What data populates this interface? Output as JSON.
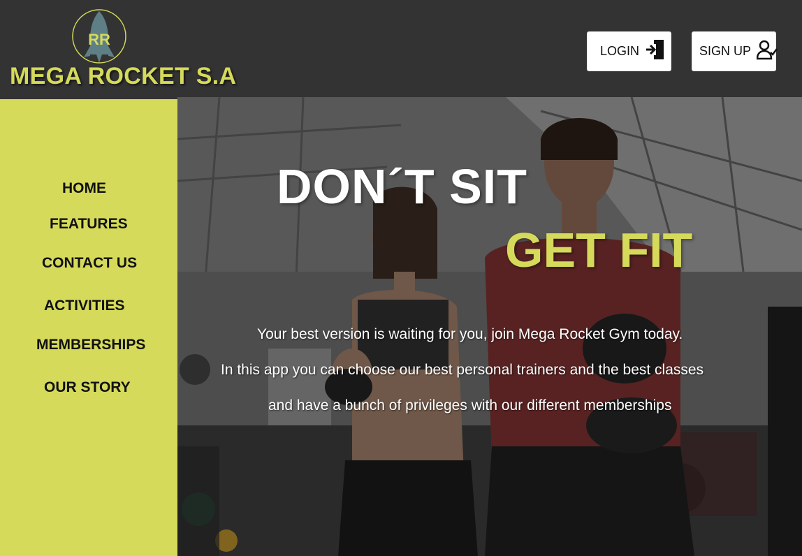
{
  "header": {
    "brand": "MEGA ROCKET S.A",
    "login_label": "LOGIN",
    "signup_label": "SIGN UP"
  },
  "sidebar": {
    "items": [
      {
        "label": "HOME"
      },
      {
        "label": "FEATURES"
      },
      {
        "label": "CONTACT US"
      },
      {
        "label": "ACTIVITIES"
      },
      {
        "label": "MEMBERSHIPS"
      },
      {
        "label": "OUR STORY"
      }
    ]
  },
  "hero": {
    "headline_1": "DON´T  SIT",
    "headline_2": "GET FIT",
    "lines": [
      "Your best version is waiting for you, join Mega Rocket Gym today.",
      "In this app you can choose our best personal trainers and the best classes",
      "and have a bunch of privileges with our different memberships"
    ]
  },
  "colors": {
    "accent": "#d5da5b",
    "header_bg": "#333333",
    "button_bg": "#ffffff",
    "text_dark": "#111111"
  },
  "icons": [
    "rocket-logo-icon",
    "login-door-icon",
    "signup-user-check-icon"
  ]
}
